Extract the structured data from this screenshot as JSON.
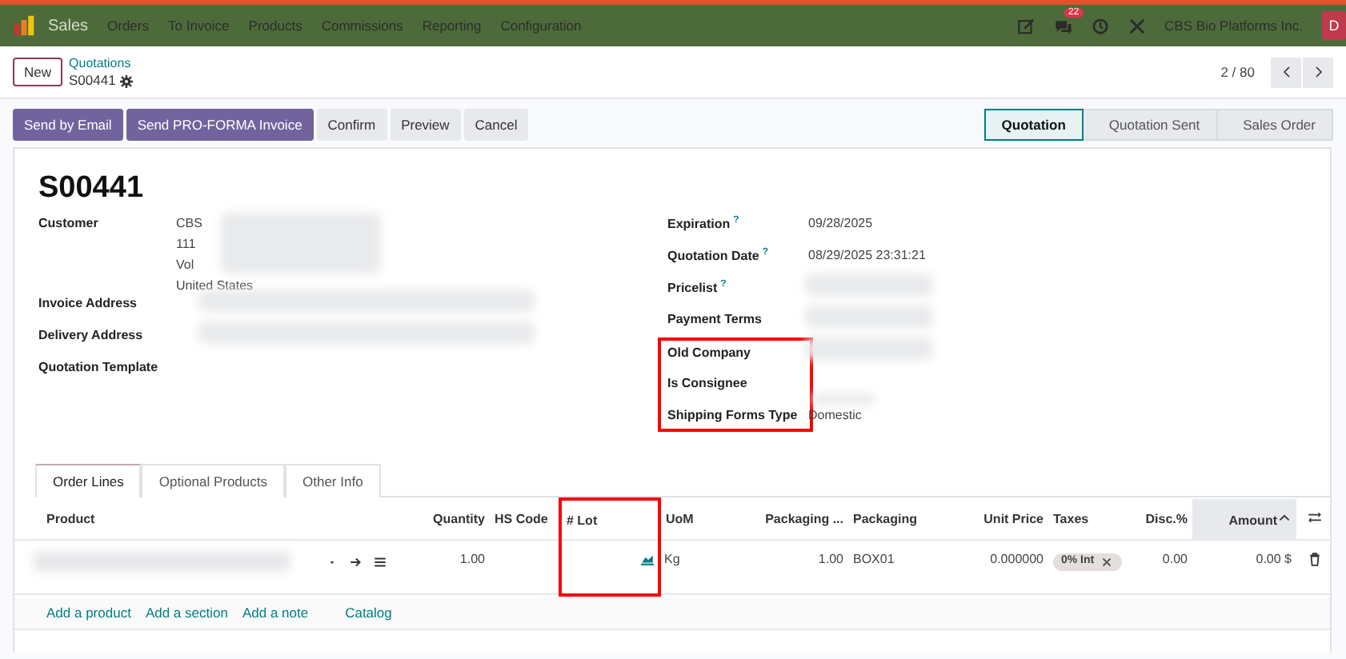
{
  "navbar": {
    "app": "Sales",
    "menu": [
      "Orders",
      "To Invoice",
      "Products",
      "Commissions",
      "Reporting",
      "Configuration"
    ],
    "message_count": "22",
    "company": "CBS Bio Platforms Inc.",
    "avatar": "D"
  },
  "control_panel": {
    "new_button": "New",
    "parent": "Quotations",
    "record": "S00441",
    "pager": "2 / 80"
  },
  "actions": [
    {
      "label": "Send by Email",
      "primary": true
    },
    {
      "label": "Send PRO-FORMA Invoice",
      "primary": true
    },
    {
      "label": "Confirm",
      "primary": false
    },
    {
      "label": "Preview",
      "primary": false
    },
    {
      "label": "Cancel",
      "primary": false
    }
  ],
  "statusbar": [
    {
      "label": "Quotation",
      "selected": true
    },
    {
      "label": "Quotation Sent",
      "selected": false
    },
    {
      "label": "Sales Order",
      "selected": false
    }
  ],
  "title": "S00441",
  "left_fields": [
    {
      "label": "Customer",
      "lines": [
        "CBS",
        "111",
        "Vol",
        "United States"
      ],
      "redacted": true
    },
    {
      "label": "Invoice Address",
      "redacted": true
    },
    {
      "label": "Delivery Address",
      "redacted": true
    },
    {
      "label": "Quotation Template",
      "redacted": false
    }
  ],
  "right_fields": [
    {
      "label": "Expiration",
      "help": "?",
      "value": "09/28/2025",
      "redacted": false,
      "highlighted": false
    },
    {
      "label": "Quotation Date",
      "help": "?",
      "value": "08/29/2025 23:31:21",
      "redacted": false,
      "highlighted": false
    },
    {
      "label": "Pricelist",
      "help": "?",
      "redacted": true,
      "highlighted": false
    },
    {
      "label": "Payment Terms",
      "redacted": true,
      "highlighted": false
    },
    {
      "label": "Old Company",
      "redacted": true,
      "highlighted": true
    },
    {
      "label": "Is Consignee",
      "redacted": false,
      "highlighted": true
    },
    {
      "label": "Shipping Forms Type",
      "value": "Domestic",
      "redacted": true,
      "highlighted": true
    }
  ],
  "tabs": [
    {
      "label": "Order Lines",
      "selected": true
    },
    {
      "label": "Optional Products",
      "selected": false
    },
    {
      "label": "Other Info",
      "selected": false
    }
  ],
  "table": {
    "columns": [
      {
        "label": "Product",
        "kind": "text",
        "highlighted": false,
        "sorted": false
      },
      {
        "label": "Quantity",
        "kind": "number",
        "highlighted": false,
        "sorted": false
      },
      {
        "label": "HS Code",
        "kind": "text",
        "highlighted": false,
        "sorted": false
      },
      {
        "label": "# Lot",
        "kind": "text",
        "highlighted": true,
        "sorted": false
      },
      {
        "label": "UoM",
        "kind": "text",
        "highlighted": false,
        "sorted": false
      },
      {
        "label": "Packaging ...",
        "kind": "number",
        "highlighted": false,
        "sorted": false
      },
      {
        "label": "Packaging",
        "kind": "text",
        "highlighted": false,
        "sorted": false
      },
      {
        "label": "Unit Price",
        "kind": "number",
        "highlighted": false,
        "sorted": false
      },
      {
        "label": "Taxes",
        "kind": "text",
        "highlighted": false,
        "sorted": false
      },
      {
        "label": "Disc.%",
        "kind": "number",
        "highlighted": false,
        "sorted": false
      },
      {
        "label": "Amount",
        "kind": "number",
        "highlighted": false,
        "sorted": true
      }
    ],
    "rows": [
      {
        "product_redacted": true,
        "quantity": "1.00",
        "uom": "Kg",
        "packaging_qty": "1.00",
        "packaging": "BOX01",
        "unit_price": "0.000000",
        "taxes": [
          "0% Int"
        ],
        "discount": "0.00",
        "amount": "0.00 $"
      }
    ],
    "add_links": [
      "Add a product",
      "Add a section",
      "Add a note",
      "Catalog"
    ]
  }
}
